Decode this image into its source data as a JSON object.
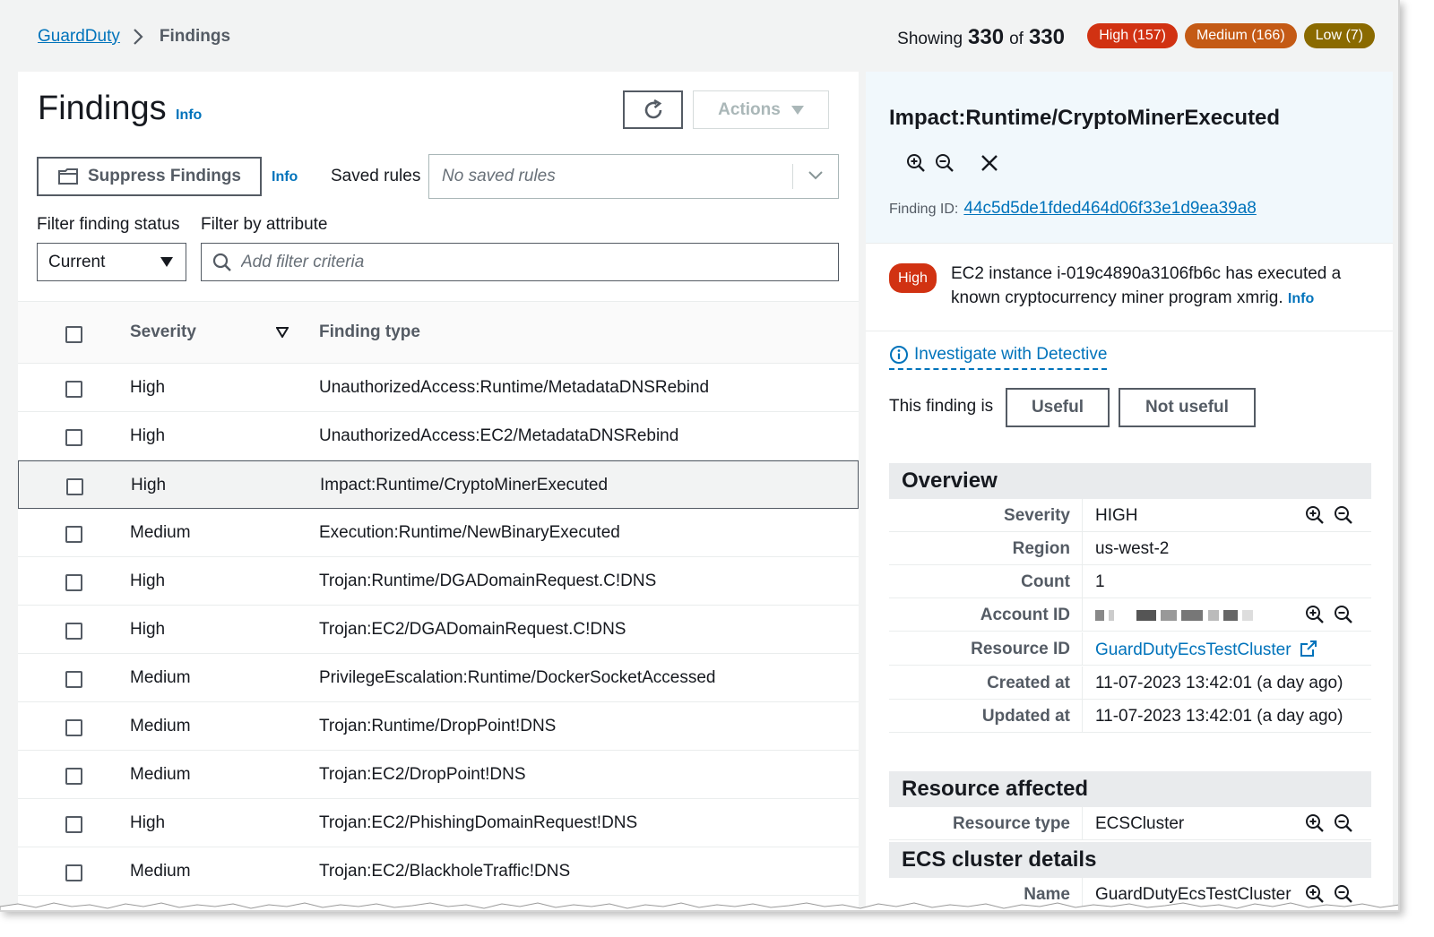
{
  "breadcrumb": {
    "root": "GuardDuty",
    "current": "Findings"
  },
  "summary_bar": {
    "showing_label": "Showing",
    "shown": "330",
    "of_label": "of",
    "total": "330",
    "badges": [
      {
        "label": "High (157)",
        "color": "#d13212"
      },
      {
        "label": "Medium (166)",
        "color": "#c45a15"
      },
      {
        "label": "Low (7)",
        "color": "#8a6a00"
      }
    ]
  },
  "left": {
    "title": "Findings",
    "info": "Info",
    "refresh_icon": "refresh-icon",
    "actions_label": "Actions",
    "suppress_label": "Suppress Findings",
    "suppress_info": "Info",
    "saved_rules_label": "Saved rules",
    "saved_rules_placeholder": "No saved rules",
    "filter_status_label": "Filter finding status",
    "filter_attr_label": "Filter by attribute",
    "status_value": "Current",
    "filter_placeholder": "Add filter criteria",
    "columns": {
      "severity": "Severity",
      "finding_type": "Finding type"
    }
  },
  "rows": [
    {
      "severity": "High",
      "type": "UnauthorizedAccess:Runtime/MetadataDNSRebind"
    },
    {
      "severity": "High",
      "type": "UnauthorizedAccess:EC2/MetadataDNSRebind"
    },
    {
      "severity": "High",
      "type": "Impact:Runtime/CryptoMinerExecuted",
      "selected": true
    },
    {
      "severity": "Medium",
      "type": "Execution:Runtime/NewBinaryExecuted"
    },
    {
      "severity": "High",
      "type": "Trojan:Runtime/DGADomainRequest.C!DNS"
    },
    {
      "severity": "High",
      "type": "Trojan:EC2/DGADomainRequest.C!DNS"
    },
    {
      "severity": "Medium",
      "type": "PrivilegeEscalation:Runtime/DockerSocketAccessed"
    },
    {
      "severity": "Medium",
      "type": "Trojan:Runtime/DropPoint!DNS"
    },
    {
      "severity": "Medium",
      "type": "Trojan:EC2/DropPoint!DNS"
    },
    {
      "severity": "High",
      "type": "Trojan:EC2/PhishingDomainRequest!DNS"
    },
    {
      "severity": "Medium",
      "type": "Trojan:EC2/BlackholeTraffic!DNS"
    }
  ],
  "detail": {
    "title": "Impact:Runtime/CryptoMinerExecuted",
    "finding_id_label": "Finding ID:",
    "finding_id": "44c5d5de1fded464d06f33e1d9ea39a8",
    "severity_badge": "High",
    "summary": "EC2 instance i-019c4890a3106fb6c has executed a known cryptocurrency miner program xmrig.",
    "summary_info": "Info",
    "investigate": "Investigate with Detective",
    "feedback_label": "This finding is",
    "useful": "Useful",
    "not_useful": "Not useful",
    "overview_title": "Overview",
    "overview": {
      "severity": {
        "k": "Severity",
        "v": "HIGH"
      },
      "region": {
        "k": "Region",
        "v": "us-west-2"
      },
      "count": {
        "k": "Count",
        "v": "1"
      },
      "account": {
        "k": "Account ID",
        "v": ""
      },
      "resource_id": {
        "k": "Resource ID",
        "v": "GuardDutyEcsTestCluster"
      },
      "created": {
        "k": "Created at",
        "v": "11-07-2023 13:42:01 (a day ago)"
      },
      "updated": {
        "k": "Updated at",
        "v": "11-07-2023 13:42:01 (a day ago)"
      }
    },
    "resource_title": "Resource affected",
    "resource_type": {
      "k": "Resource type",
      "v": "ECSCluster"
    },
    "ecs_title": "ECS cluster details",
    "ecs_name": {
      "k": "Name",
      "v": "GuardDutyEcsTestCluster"
    }
  }
}
